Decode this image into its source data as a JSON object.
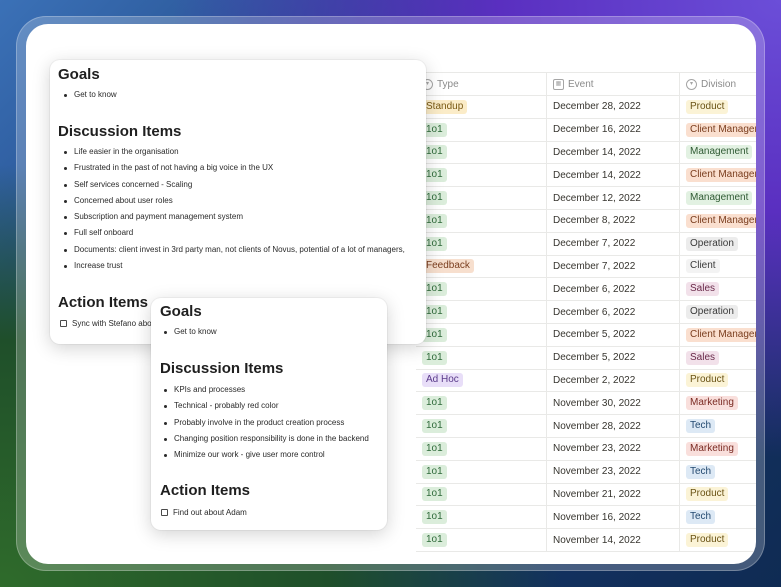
{
  "table": {
    "headers": {
      "type": "Type",
      "event": "Event",
      "division": "Division"
    },
    "rows": [
      {
        "type": "Standup",
        "type_bg": "#fbecc8",
        "type_fg": "#7a5a14",
        "date": "December 28, 2022",
        "division": "Product",
        "div_bg": "#fbf3d6",
        "div_fg": "#6a5315"
      },
      {
        "type": "1o1",
        "type_bg": "#dbeddb",
        "type_fg": "#2f6a3a",
        "date": "December 16, 2022",
        "division": "Client Managen",
        "div_bg": "#fadfcf",
        "div_fg": "#7a3d1e"
      },
      {
        "type": "1o1",
        "type_bg": "#dbeddb",
        "type_fg": "#2f6a3a",
        "date": "December 14, 2022",
        "division": "Management",
        "div_bg": "#e2f1e2",
        "div_fg": "#2f5a33"
      },
      {
        "type": "1o1",
        "type_bg": "#dbeddb",
        "type_fg": "#2f6a3a",
        "date": "December 14, 2022",
        "division": "Client Managen",
        "div_bg": "#fadfcf",
        "div_fg": "#7a3d1e"
      },
      {
        "type": "1o1",
        "type_bg": "#dbeddb",
        "type_fg": "#2f6a3a",
        "date": "December 12, 2022",
        "division": "Management",
        "div_bg": "#e2f1e2",
        "div_fg": "#2f5a33"
      },
      {
        "type": "1o1",
        "type_bg": "#dbeddb",
        "type_fg": "#2f6a3a",
        "date": "December 8, 2022",
        "division": "Client Managen",
        "div_bg": "#fadfcf",
        "div_fg": "#7a3d1e"
      },
      {
        "type": "1o1",
        "type_bg": "#dbeddb",
        "type_fg": "#2f6a3a",
        "date": "December 7, 2022",
        "division": "Operation",
        "div_bg": "#ececec",
        "div_fg": "#3a3a3a"
      },
      {
        "type": "Feedback",
        "type_bg": "#f7dfce",
        "type_fg": "#7a3d1e",
        "date": "December 7, 2022",
        "division": "Client",
        "div_bg": "#f3f3f3",
        "div_fg": "#3a3a3a"
      },
      {
        "type": "1o1",
        "type_bg": "#dbeddb",
        "type_fg": "#2f6a3a",
        "date": "December 6, 2022",
        "division": "Sales",
        "div_bg": "#f2e1ea",
        "div_fg": "#6a2a4a"
      },
      {
        "type": "1o1",
        "type_bg": "#dbeddb",
        "type_fg": "#2f6a3a",
        "date": "December 6, 2022",
        "division": "Operation",
        "div_bg": "#ececec",
        "div_fg": "#3a3a3a"
      },
      {
        "type": "1o1",
        "type_bg": "#dbeddb",
        "type_fg": "#2f6a3a",
        "date": "December 5, 2022",
        "division": "Client Managen",
        "div_bg": "#fadfcf",
        "div_fg": "#7a3d1e"
      },
      {
        "type": "1o1",
        "type_bg": "#dbeddb",
        "type_fg": "#2f6a3a",
        "date": "December 5, 2022",
        "division": "Sales",
        "div_bg": "#f2e1ea",
        "div_fg": "#6a2a4a"
      },
      {
        "type": "Ad Hoc",
        "type_bg": "#e8def8",
        "type_fg": "#5a3a8a",
        "date": "December 2, 2022",
        "division": "Product",
        "div_bg": "#fbf3d6",
        "div_fg": "#6a5315"
      },
      {
        "type": "1o1",
        "type_bg": "#dbeddb",
        "type_fg": "#2f6a3a",
        "date": "November 30, 2022",
        "division": "Marketing",
        "div_bg": "#f9dfdc",
        "div_fg": "#7a2a22"
      },
      {
        "type": "1o1",
        "type_bg": "#dbeddb",
        "type_fg": "#2f6a3a",
        "date": "November 28, 2022",
        "division": "Tech",
        "div_bg": "#dde9f5",
        "div_fg": "#244a70"
      },
      {
        "type": "1o1",
        "type_bg": "#dbeddb",
        "type_fg": "#2f6a3a",
        "date": "November 23, 2022",
        "division": "Marketing",
        "div_bg": "#f9dfdc",
        "div_fg": "#7a2a22"
      },
      {
        "type": "1o1",
        "type_bg": "#dbeddb",
        "type_fg": "#2f6a3a",
        "date": "November 23, 2022",
        "division": "Tech",
        "div_bg": "#dde9f5",
        "div_fg": "#244a70"
      },
      {
        "type": "1o1",
        "type_bg": "#dbeddb",
        "type_fg": "#2f6a3a",
        "date": "November 21, 2022",
        "division": "Product",
        "div_bg": "#fbf3d6",
        "div_fg": "#6a5315"
      },
      {
        "type": "1o1",
        "type_bg": "#dbeddb",
        "type_fg": "#2f6a3a",
        "date": "November 16, 2022",
        "division": "Tech",
        "div_bg": "#dde9f5",
        "div_fg": "#244a70"
      },
      {
        "type": "1o1",
        "type_bg": "#dbeddb",
        "type_fg": "#2f6a3a",
        "date": "November 14, 2022",
        "division": "Product",
        "div_bg": "#fbf3d6",
        "div_fg": "#6a5315"
      }
    ]
  },
  "note1": {
    "goals_heading": "Goals",
    "goals": [
      "Get to know"
    ],
    "discussion_heading": "Discussion Items",
    "discussion": [
      "Life easier in the organisation",
      "Frustrated in the past of not having a big voice in the UX",
      "Self services concerned - Scaling",
      "Concerned about user roles",
      "Subscription and payment management system",
      "Full self onboard",
      "Documents: client invest in 3rd party man, not clients of Novus, potential of a lot of managers,",
      "Increase trust"
    ],
    "action_heading": "Action Items",
    "action_items": [
      "Sync with Stefano abo"
    ]
  },
  "note2": {
    "goals_heading": "Goals",
    "goals": [
      "Get to know"
    ],
    "discussion_heading": "Discussion Items",
    "discussion": [
      "KPIs and processes",
      "Technical - probably red color",
      "Probably involve in the product creation process",
      "Changing position responsibility is done in the backend",
      "Minimize our work - give user more control"
    ],
    "action_heading": "Action Items",
    "action_items": [
      "Find out about Adam"
    ]
  }
}
